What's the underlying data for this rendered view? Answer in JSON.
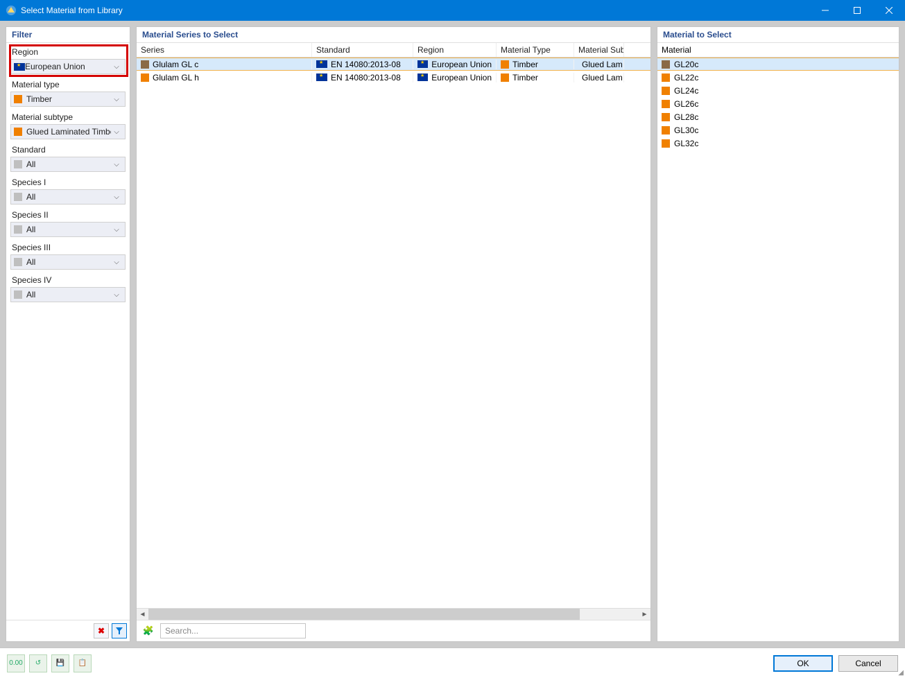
{
  "window": {
    "title": "Select Material from Library"
  },
  "filter": {
    "header": "Filter",
    "groups": [
      {
        "label": "Region",
        "value": "European Union",
        "swatch": "eu",
        "highlighted": true
      },
      {
        "label": "Material type",
        "value": "Timber",
        "swatch": "orange"
      },
      {
        "label": "Material subtype",
        "value": "Glued Laminated Timber",
        "swatch": "orange"
      },
      {
        "label": "Standard",
        "value": "All",
        "swatch": "gray"
      },
      {
        "label": "Species I",
        "value": "All",
        "swatch": "gray"
      },
      {
        "label": "Species II",
        "value": "All",
        "swatch": "gray"
      },
      {
        "label": "Species III",
        "value": "All",
        "swatch": "gray"
      },
      {
        "label": "Species IV",
        "value": "All",
        "swatch": "gray"
      }
    ]
  },
  "series": {
    "header": "Material Series to Select",
    "columns": [
      "Series",
      "Standard",
      "Region",
      "Material Type",
      "Material Subt"
    ],
    "rows": [
      {
        "series": "Glulam GL c",
        "swatch": "brown",
        "standard": "EN 14080:2013-08",
        "region": "European Union",
        "mtype": "Timber",
        "msub": "Glued Lam",
        "selected": true
      },
      {
        "series": "Glulam GL h",
        "swatch": "orange",
        "standard": "EN 14080:2013-08",
        "region": "European Union",
        "mtype": "Timber",
        "msub": "Glued Lam",
        "selected": false
      }
    ],
    "search_placeholder": "Search..."
  },
  "materials": {
    "header": "Material to Select",
    "column": "Material",
    "rows": [
      {
        "name": "GL20c",
        "swatch": "brown",
        "selected": true
      },
      {
        "name": "GL22c",
        "swatch": "orange",
        "selected": false
      },
      {
        "name": "GL24c",
        "swatch": "orange",
        "selected": false
      },
      {
        "name": "GL26c",
        "swatch": "orange",
        "selected": false
      },
      {
        "name": "GL28c",
        "swatch": "orange",
        "selected": false
      },
      {
        "name": "GL30c",
        "swatch": "orange",
        "selected": false
      },
      {
        "name": "GL32c",
        "swatch": "orange",
        "selected": false
      }
    ]
  },
  "buttons": {
    "ok": "OK",
    "cancel": "Cancel"
  },
  "toolbar_icons": {
    "a": "0.00",
    "b": "↺",
    "c": "💾",
    "d": "📋"
  }
}
